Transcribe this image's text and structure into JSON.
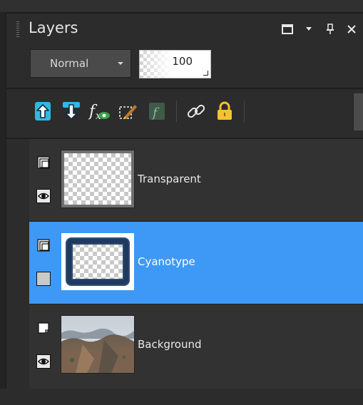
{
  "panel": {
    "title": "Layers"
  },
  "controls": {
    "blend_mode": "Normal",
    "opacity": "100"
  },
  "toolbar": {
    "icons": [
      "move-layer-up-icon",
      "move-layer-down-icon",
      "layer-styles-fx-icon",
      "edit-selection-icon",
      "script-icon",
      "link-icon",
      "lock-icon"
    ]
  },
  "layers": [
    {
      "name": "Transparent",
      "visible": true,
      "selected": false
    },
    {
      "name": "Cyanotype",
      "visible": false,
      "selected": true
    },
    {
      "name": "Background",
      "visible": true,
      "selected": false
    }
  ],
  "colors": {
    "selection": "#3d99f5",
    "panel_bg": "#2c2c2c",
    "toolbar_accent": "#2fb8e6",
    "lock": "#f2c230"
  }
}
